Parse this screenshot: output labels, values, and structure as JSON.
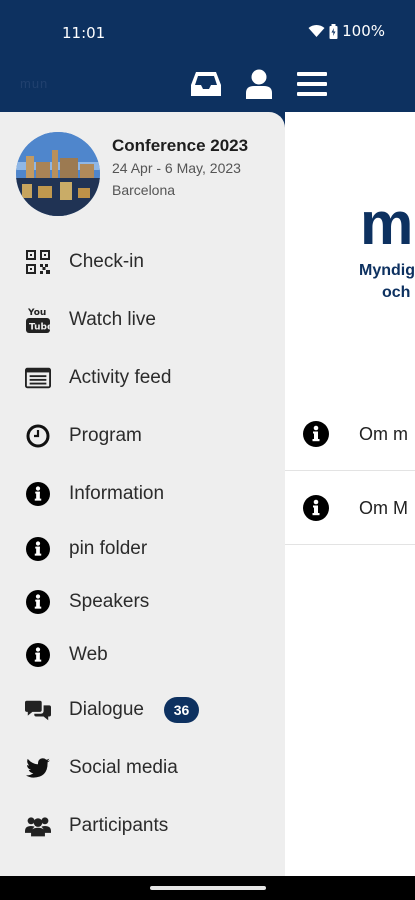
{
  "status": {
    "time": "11:01",
    "battery": "100%"
  },
  "appbar": {
    "logo_text": "mun",
    "inbox_icon": "inbox-icon",
    "profile_icon": "profile-icon",
    "menu_icon": "hamburger-icon"
  },
  "main": {
    "logo_text": "m",
    "subtitle_line1": "Myndig",
    "subtitle_line2": "och",
    "rows": [
      {
        "icon": "info-icon",
        "label": "Om m"
      },
      {
        "icon": "info-icon",
        "label": "Om M"
      }
    ]
  },
  "event": {
    "title": "Conference 2023",
    "dates": "24 Apr - 6 May, 2023",
    "location": "Barcelona"
  },
  "menu": [
    {
      "icon": "qr-code-icon",
      "label": "Check-in"
    },
    {
      "icon": "youtube-icon",
      "label": "Watch live"
    },
    {
      "icon": "feed-icon",
      "label": "Activity feed"
    },
    {
      "icon": "clock-icon",
      "label": "Program"
    },
    {
      "icon": "info-icon",
      "label": "Information"
    },
    {
      "icon": "info-icon",
      "label": "pin folder"
    },
    {
      "icon": "info-icon",
      "label": "Speakers"
    },
    {
      "icon": "info-icon",
      "label": "Web"
    },
    {
      "icon": "chat-icon",
      "label": "Dialogue",
      "badge": "36"
    },
    {
      "icon": "twitter-icon",
      "label": "Social media"
    },
    {
      "icon": "people-icon",
      "label": "Participants"
    }
  ],
  "colors": {
    "primary": "#0d3160",
    "drawer_bg": "#eeeeee",
    "text": "#2b2b2b"
  }
}
